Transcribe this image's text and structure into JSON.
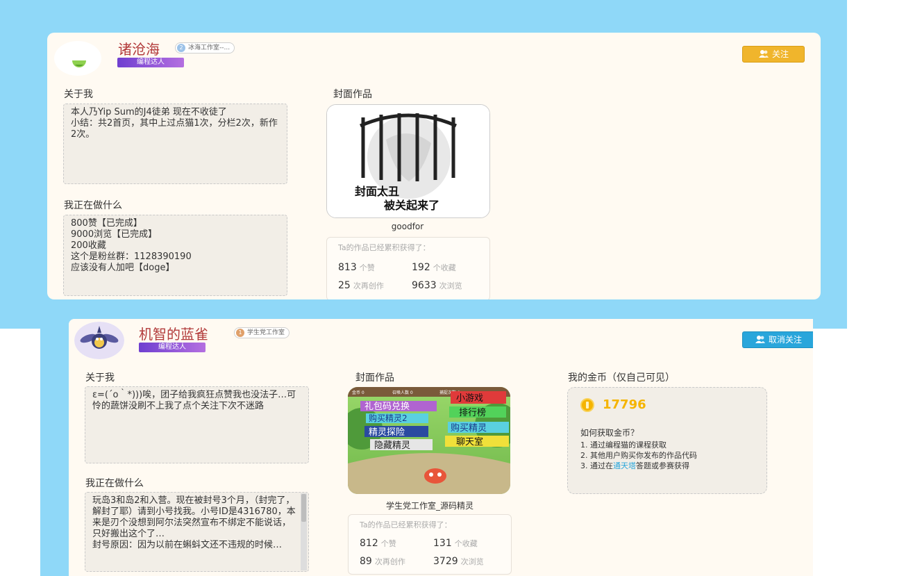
{
  "colors": {
    "background_blue": "#8fd8f8",
    "card": "#fffaf2",
    "name_red": "#b23b3b",
    "follow_yellow": "#f0b52c",
    "unfollow_blue": "#29a6db",
    "coin_gold": "#f5b400"
  },
  "profiles": [
    {
      "name": "诸沧海",
      "studio_level": "2",
      "studio": "冰海工作室--...",
      "badge": "编程达人",
      "action_label": "关注",
      "about_label": "关于我",
      "about_text": "本人乃Yip Sum的J4徒弟 现在不收徒了\n小结：共2首页，其中上过点猫1次，分栏2次，新作2次。",
      "doing_label": "我正在做什么",
      "doing_text": "800赞【已完成】\n9000浏览【已完成】\n200收藏\n这个是粉丝群：1128390190\n应该没有人加吧【doge】",
      "cover_label": "封面作品",
      "cover_image_text": [
        "封面太丑",
        "被关起来了"
      ],
      "cover_title": "goodfor",
      "stats_header": "Ta的作品已经累积获得了：",
      "stats": [
        {
          "value": "813",
          "unit": "个赞"
        },
        {
          "value": "192",
          "unit": "个收藏"
        },
        {
          "value": "25",
          "unit": "次再创作"
        },
        {
          "value": "9633",
          "unit": "次浏览"
        }
      ]
    },
    {
      "name": "机智的蓝雀",
      "studio_level": "1",
      "studio": "学生党工作室",
      "badge": "编程达人",
      "action_label": "取消关注",
      "about_label": "关于我",
      "about_text": "ε=(´ο｀*)))唉，团子给我疯狂点赞我也没法子…可怜的蔬饼没刷不上我了点个关注下次不迷路",
      "doing_label": "我正在做什么",
      "doing_text": "玩岛3和岛2和入营。现在被封号3个月，（封完了，解封了耶）请到小号找我。小号ID是4316780，本来是刃个没想到阿尔法突然宣布不绑定不能说话，只好搬出这个了…\n封号原因：因为以前在蝌蚪文还不违规的时候…",
      "cover_label": "封面作品",
      "cover_title": "学生党工作室_源码精灵",
      "cover_game": {
        "topbar": [
          "金币 0",
          "召唤人数 0",
          "捕捉次数 0"
        ],
        "left_buttons": [
          "礼包码兑换",
          "购买精灵2",
          "精灵探险",
          "隐藏精灵"
        ],
        "right_buttons": [
          "小游戏",
          "排行榜",
          "购买精灵",
          "聊天室"
        ]
      },
      "stats_header": "Ta的作品已经累积获得了：",
      "stats": [
        {
          "value": "812",
          "unit": "个赞"
        },
        {
          "value": "131",
          "unit": "个收藏"
        },
        {
          "value": "89",
          "unit": "次再创作"
        },
        {
          "value": "3729",
          "unit": "次浏览"
        }
      ],
      "coins_label": "我的金币（仅自己可见）",
      "coins_value": "17796",
      "coins_howto_title": "如何获取金币？",
      "coins_howto": [
        "1. 通过编程猫的课程获取",
        "2. 其他用户购买你发布的作品代码",
        "3. 通过在"
      ],
      "coins_link": "通天塔",
      "coins_howto_tail": "答题或参赛获得"
    }
  ]
}
